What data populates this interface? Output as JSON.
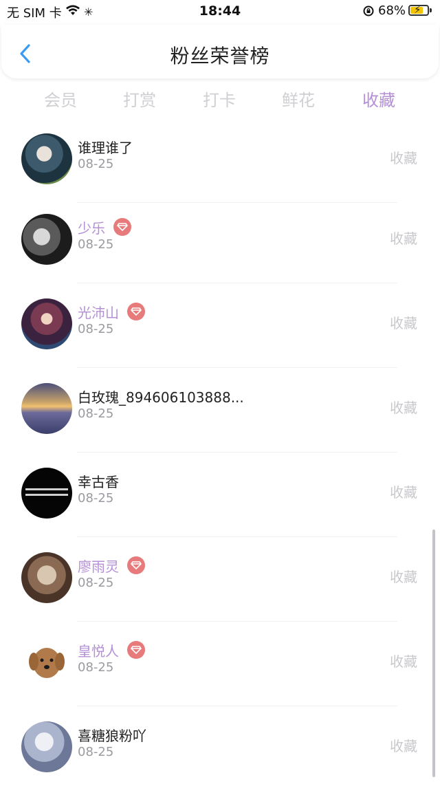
{
  "status_bar": {
    "carrier": "无 SIM 卡",
    "time": "18:44",
    "battery": "68%"
  },
  "nav": {
    "title": "粉丝荣誉榜",
    "back_icon": "chevron-left-icon"
  },
  "tabs": [
    {
      "label": "会员",
      "active": false
    },
    {
      "label": "打赏",
      "active": false
    },
    {
      "label": "打卡",
      "active": false
    },
    {
      "label": "鲜花",
      "active": false
    },
    {
      "label": "收藏",
      "active": true
    }
  ],
  "colors": {
    "accent": "#b58fd6",
    "vip_badge": "#e77a7a",
    "muted": "#c8c8cc"
  },
  "list": [
    {
      "name": "谁理谁了",
      "date": "08-25",
      "vip": false,
      "action": "收藏"
    },
    {
      "name": "少乐",
      "date": "08-25",
      "vip": true,
      "action": "收藏"
    },
    {
      "name": "光沛山",
      "date": "08-25",
      "vip": true,
      "action": "收藏"
    },
    {
      "name": "白玫瑰_894606103888...",
      "date": "08-25",
      "vip": false,
      "action": "收藏"
    },
    {
      "name": "幸古香",
      "date": "08-25",
      "vip": false,
      "action": "收藏"
    },
    {
      "name": "廖雨灵",
      "date": "08-25",
      "vip": true,
      "action": "收藏"
    },
    {
      "name": "皇悦人",
      "date": "08-25",
      "vip": true,
      "action": "收藏"
    },
    {
      "name": "喜糖狼粉吖",
      "date": "08-25",
      "vip": false,
      "action": "收藏"
    }
  ]
}
